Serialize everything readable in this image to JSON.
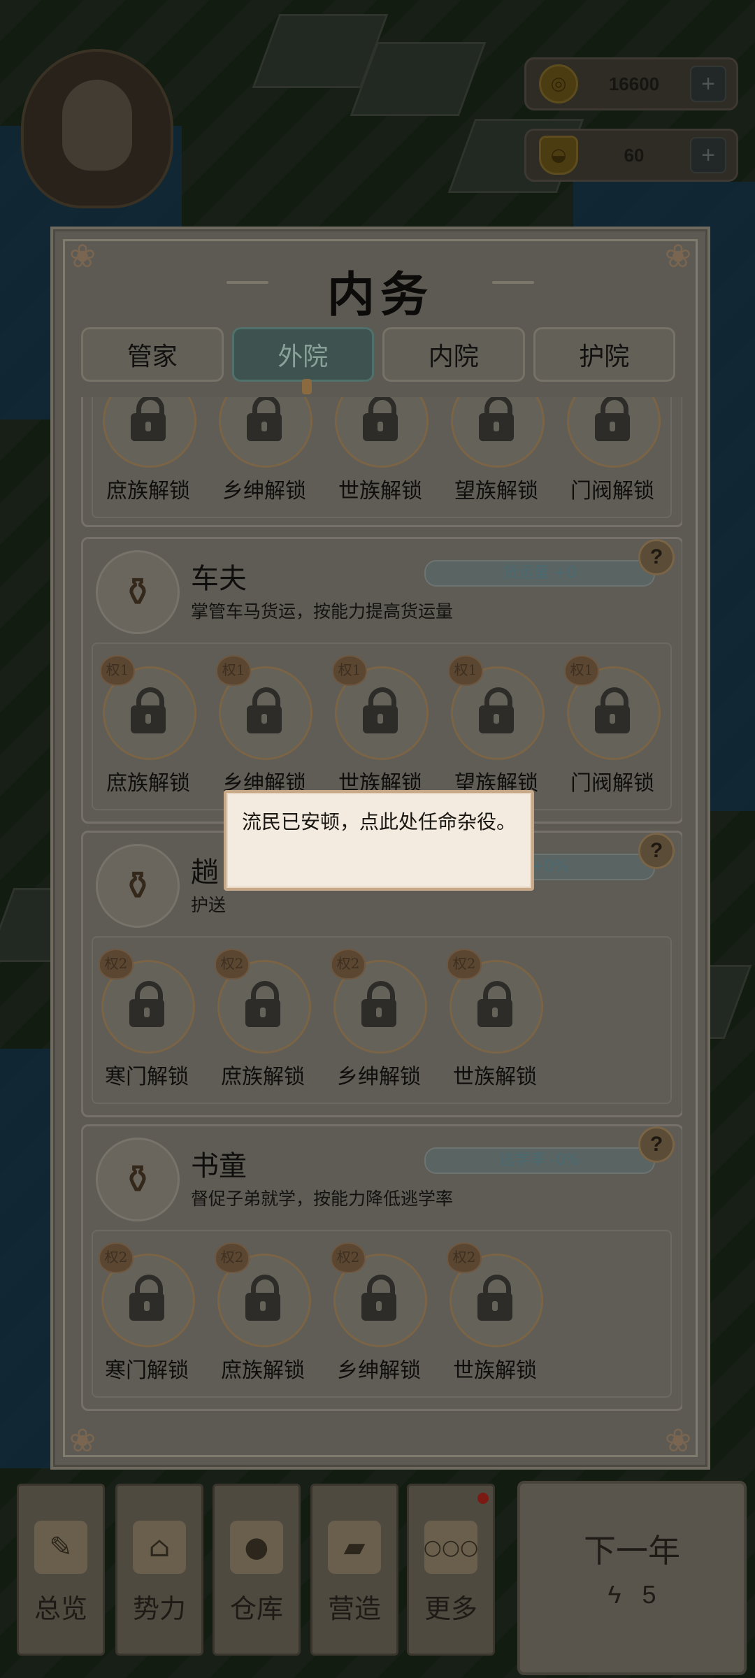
{
  "hud": {
    "coins": "16600",
    "ingots": "60",
    "plus": "+"
  },
  "modal": {
    "title": "内务",
    "tabs": [
      "管家",
      "外院",
      "内院",
      "护院"
    ],
    "active_tab": 1
  },
  "sections": [
    {
      "name": "",
      "desc": "",
      "stat": "",
      "slots": [
        {
          "rank": "",
          "label": "庶族解锁"
        },
        {
          "rank": "",
          "label": "乡绅解锁"
        },
        {
          "rank": "",
          "label": "世族解锁"
        },
        {
          "rank": "",
          "label": "望族解锁"
        },
        {
          "rank": "",
          "label": "门阀解锁"
        }
      ]
    },
    {
      "name": "车夫",
      "desc": "掌管车马货运，按能力提高货运量",
      "stat": "货运量 +0",
      "slots": [
        {
          "rank": "权1",
          "label": "庶族解锁"
        },
        {
          "rank": "权1",
          "label": "乡绅解锁"
        },
        {
          "rank": "权1",
          "label": "世族解锁"
        },
        {
          "rank": "权1",
          "label": "望族解锁"
        },
        {
          "rank": "权1",
          "label": "门阀解锁"
        }
      ]
    },
    {
      "name": "趟",
      "desc": "护送",
      "stat": "率 +0%",
      "slots": [
        {
          "rank": "权2",
          "label": "寒门解锁"
        },
        {
          "rank": "权2",
          "label": "庶族解锁"
        },
        {
          "rank": "权2",
          "label": "乡绅解锁"
        },
        {
          "rank": "权2",
          "label": "世族解锁"
        }
      ]
    },
    {
      "name": "书童",
      "desc": "督促子弟就学，按能力降低逃学率",
      "stat": "逃学率 -0%",
      "slots": [
        {
          "rank": "权2",
          "label": "寒门解锁"
        },
        {
          "rank": "权2",
          "label": "庶族解锁"
        },
        {
          "rank": "权2",
          "label": "乡绅解锁"
        },
        {
          "rank": "权2",
          "label": "世族解锁"
        }
      ]
    }
  ],
  "help_symbol": "?",
  "tooltip": "流民已安顿，点此处任命杂役。",
  "bottom_nav": [
    {
      "label": "总览",
      "icon": "brush-icon"
    },
    {
      "label": "势力",
      "icon": "palace-icon"
    },
    {
      "label": "仓库",
      "icon": "money-bag-icon"
    },
    {
      "label": "营造",
      "icon": "trowel-icon"
    },
    {
      "label": "更多",
      "icon": "more-icon"
    }
  ],
  "next_year": {
    "label": "下一年",
    "energy": "5"
  }
}
